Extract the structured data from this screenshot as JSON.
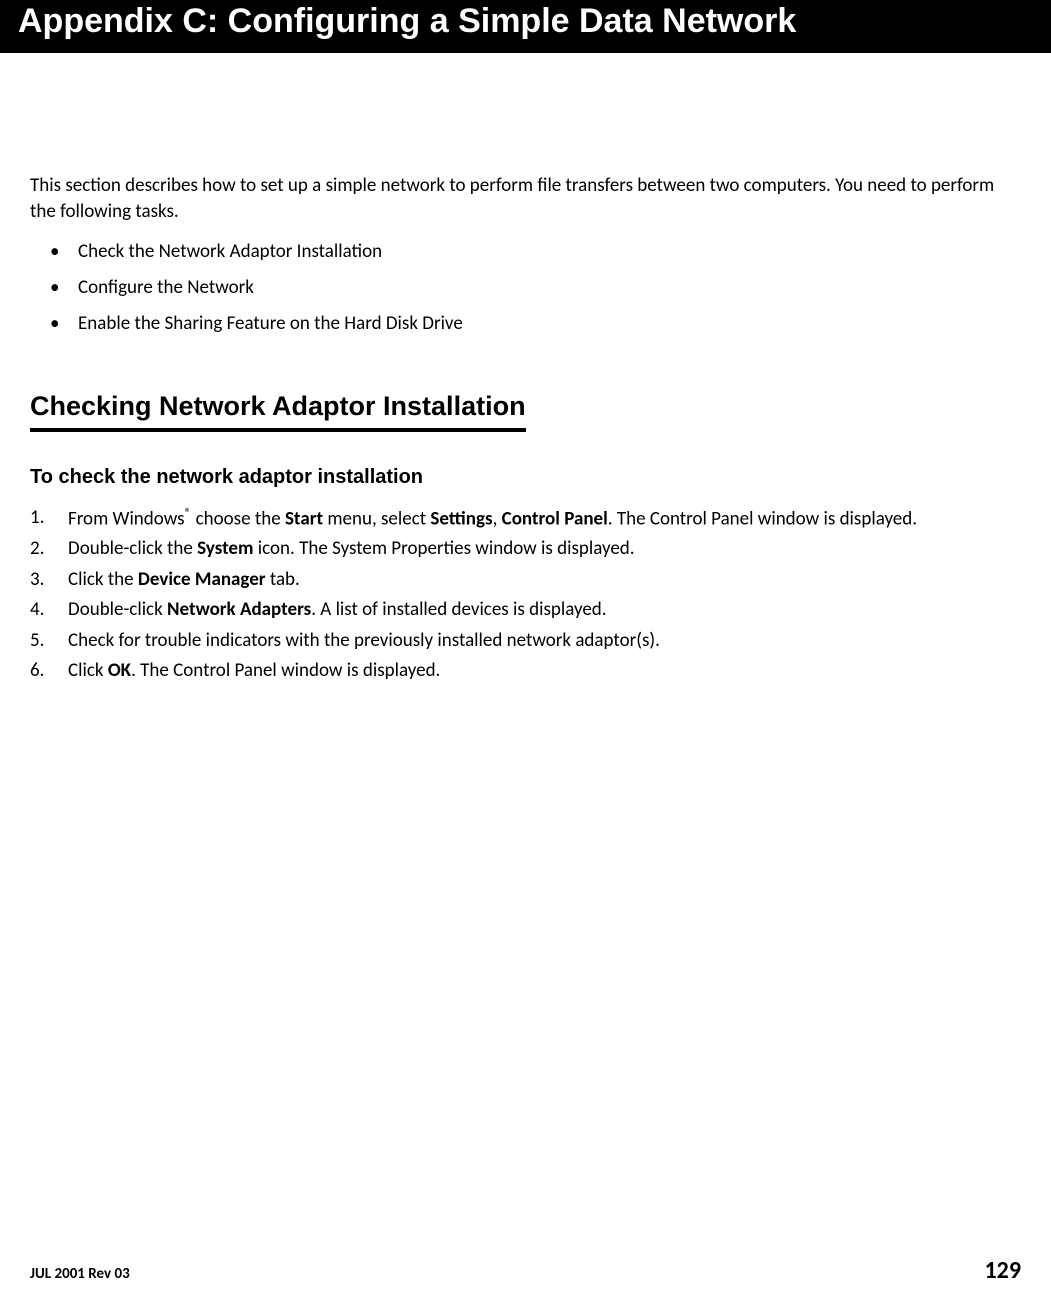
{
  "header": {
    "title": "Appendix C: Configuring a Simple Data Network"
  },
  "intro": {
    "text": "This section describes how to set up a simple network to perform file transfers between two computers. You need to perform the following tasks."
  },
  "tasks": [
    "Check the Network Adaptor Installation",
    "Configure the Network",
    "Enable the Sharing Feature on the Hard Disk Drive"
  ],
  "section": {
    "heading": "Checking Network Adaptor Installation",
    "subheading": "To check the network adaptor installation"
  },
  "steps": [
    {
      "prefix": "From Windows",
      "sup": "®",
      "t1": " choose the ",
      "b1": "Start",
      "t2": " menu, select ",
      "b2": "Settings",
      "t3": ", ",
      "b3": "Control Panel",
      "t4": ". The Control Panel window is displayed."
    },
    {
      "t1": "Double-click the ",
      "b1": "System",
      "t2": " icon. The System Properties window is displayed."
    },
    {
      "t1": "Click the ",
      "b1": "Device Manager",
      "t2": " tab."
    },
    {
      "t1": "Double-click ",
      "b1": "Network Adapters",
      "t2": ". A list of installed devices is displayed."
    },
    {
      "t1": "Check for trouble indicators with the previously installed network adaptor(s)."
    },
    {
      "t1": "Click ",
      "b1": "OK",
      "t2": ". The Control Panel window is displayed."
    }
  ],
  "footer": {
    "left": "JUL 2001 Rev 03",
    "right": "129"
  }
}
